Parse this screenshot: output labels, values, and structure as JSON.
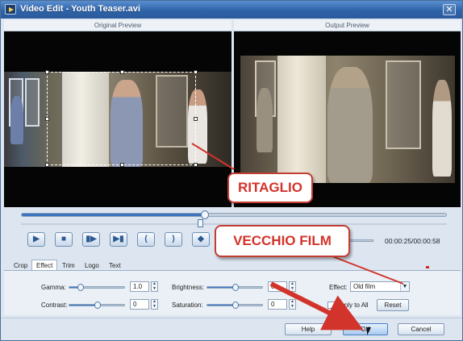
{
  "window": {
    "title": "Video Edit - Youth Teaser.avi",
    "close_glyph": "✕"
  },
  "preview": {
    "original_label": "Original Preview",
    "output_label": "Output Preview"
  },
  "playback": {
    "buttons": [
      {
        "name": "play-button",
        "glyph": "▶"
      },
      {
        "name": "stop-button",
        "glyph": "■"
      },
      {
        "name": "next-frame-button",
        "glyph": "▮▶"
      },
      {
        "name": "end-button",
        "glyph": "▶▮"
      },
      {
        "name": "mark-in-button",
        "glyph": "("
      },
      {
        "name": "mark-out-button",
        "glyph": ")"
      },
      {
        "name": "snapshot-button",
        "glyph": "◆"
      }
    ],
    "timecode": "00:00:25/00:00:58",
    "seek_position": 0.43,
    "trim_position": 0.42
  },
  "tabs": [
    {
      "label": "Crop",
      "active": false
    },
    {
      "label": "Effect",
      "active": true
    },
    {
      "label": "Trim",
      "active": false
    },
    {
      "label": "Logo",
      "active": false
    },
    {
      "label": "Text",
      "active": false
    }
  ],
  "effect": {
    "gamma": {
      "label": "Gamma:",
      "value": "1.0",
      "level": 0.2
    },
    "contrast": {
      "label": "Contrast:",
      "value": "0",
      "level": 0.5
    },
    "brightness": {
      "label": "Brightness:",
      "value": "0",
      "level": 0.5
    },
    "saturation": {
      "label": "Saturation:",
      "value": "0",
      "level": 0.5
    },
    "effect_label": "Effect:",
    "effect_value": "Old film",
    "apply_to_all": "Apply to All",
    "reset": "Reset"
  },
  "buttons": {
    "help": "Help",
    "ok": "OK",
    "cancel": "Cancel"
  },
  "annotations": {
    "crop_callout": "RITAGLIO",
    "film_callout": "VECCHIO FILM"
  },
  "colors": {
    "accent": "#3a74c0",
    "annotation_red": "#d2332a",
    "title_bar": "#2f63a8"
  }
}
